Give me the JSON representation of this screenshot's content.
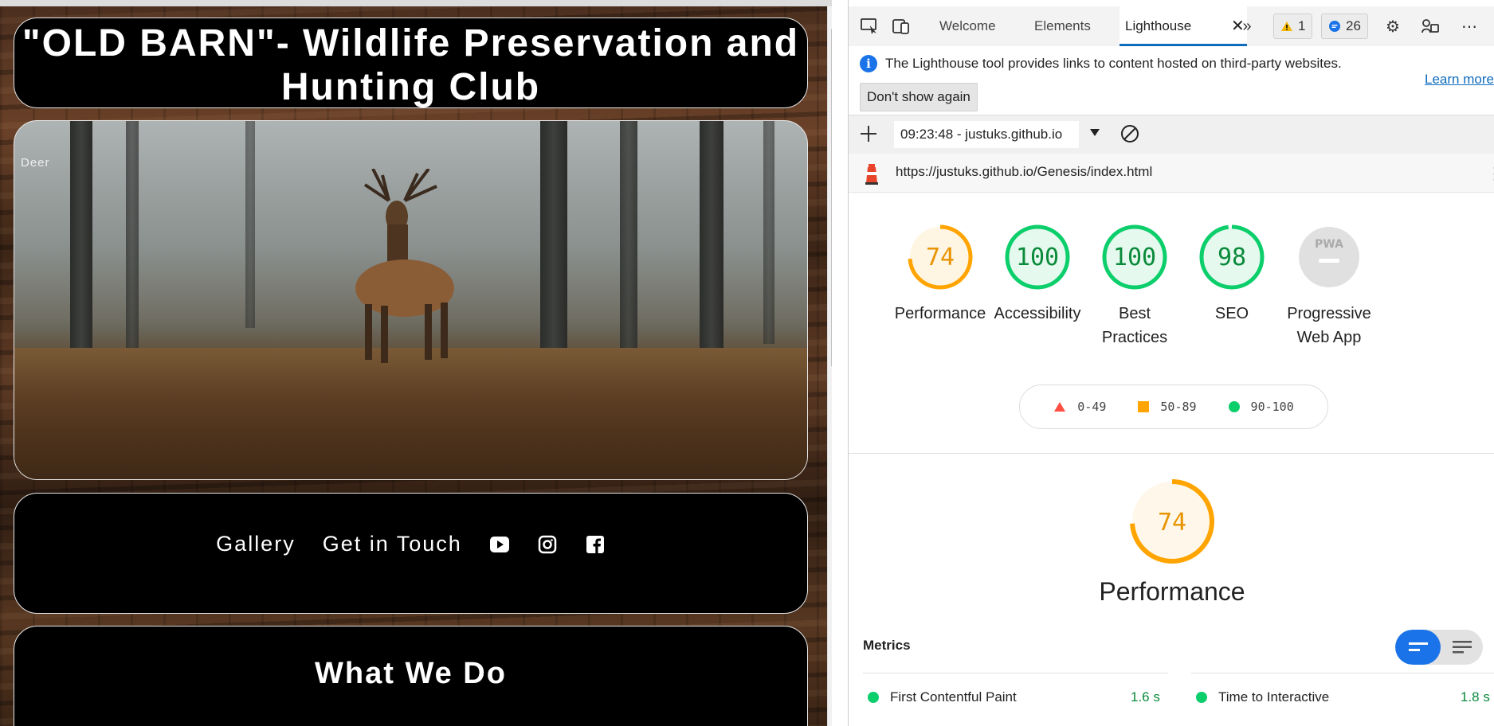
{
  "site": {
    "title": "\"OLD BARN\"- Wildlife Preservation and Hunting Club",
    "hero_alt": "Deer",
    "nav": [
      "Gallery",
      "Get in Touch"
    ],
    "social_icons": [
      "youtube-icon",
      "instagram-icon",
      "facebook-icon"
    ],
    "section_heading": "What We Do"
  },
  "devtools": {
    "tabs": [
      "Welcome",
      "Elements",
      "Lighthouse"
    ],
    "active_tab": "Lighthouse",
    "warnings_count": "1",
    "messages_count": "26",
    "infobar": {
      "text": "The Lighthouse tool provides links to content hosted on third-party websites.",
      "learn_more": "Learn more",
      "dont_show": "Don't show again"
    },
    "report_select": "09:23:48 - justuks.github.io",
    "url": "https://justuks.github.io/Genesis/index.html"
  },
  "lighthouse": {
    "scores": [
      {
        "label": "Performance",
        "value": "74",
        "status": "average"
      },
      {
        "label": "Accessibility",
        "value": "100",
        "status": "pass"
      },
      {
        "label": "Best Practices",
        "value": "100",
        "status": "pass"
      },
      {
        "label": "SEO",
        "value": "98",
        "status": "pass"
      },
      {
        "label": "Progressive Web App",
        "value": "PWA",
        "status": "na"
      }
    ],
    "legend": [
      "0-49",
      "50-89",
      "90-100"
    ],
    "performance": {
      "value": "74",
      "title": "Performance"
    },
    "metrics_title": "Metrics",
    "metrics": [
      {
        "name": "First Contentful Paint",
        "value": "1.6 s"
      },
      {
        "name": "Time to Interactive",
        "value": "1.8 s"
      }
    ],
    "colors": {
      "pass": "#0cce6b",
      "average": "#ffa400",
      "fail": "#ff4e42",
      "na": "#e0e0e0"
    }
  }
}
